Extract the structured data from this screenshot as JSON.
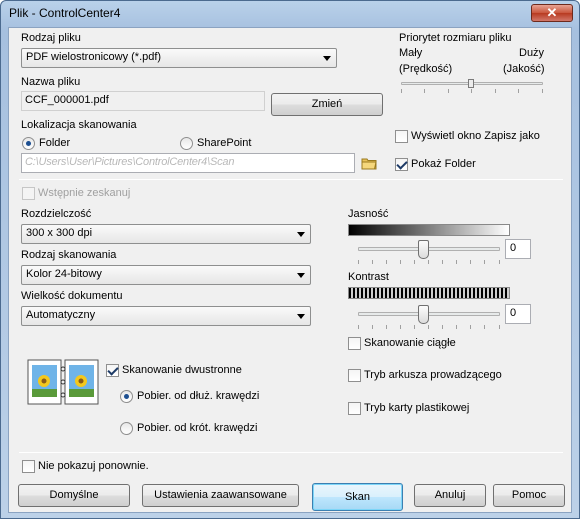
{
  "window": {
    "title": "Plik - ControlCenter4",
    "close_label": "✕"
  },
  "file_type": {
    "label": "Rodzaj pliku",
    "value": "PDF wielostronicowy (*.pdf)"
  },
  "file_name": {
    "label": "Nazwa pliku",
    "value": "CCF_000001.pdf",
    "change_button": "Zmień"
  },
  "size_priority": {
    "label": "Priorytet rozmiaru pliku",
    "left": "Mały",
    "left_sub": "(Prędkość)",
    "right": "Duży",
    "right_sub": "(Jakość)",
    "level": 0.6
  },
  "location": {
    "label": "Lokalizacja skanowania",
    "folder": "Folder",
    "sharepoint": "SharePoint",
    "path": "C:\\Users\\User\\Pictures\\ControlCenter4\\Scan"
  },
  "options": {
    "show_save_as": "Wyświetl okno Zapisz jako",
    "show_folder": "Pokaż Folder",
    "prescan": "Wstępnie zeskanuj"
  },
  "resolution": {
    "label": "Rozdzielczość",
    "value": "300 x 300 dpi"
  },
  "scan_type": {
    "label": "Rodzaj skanowania",
    "value": "Kolor 24-bitowy"
  },
  "doc_size": {
    "label": "Wielkość dokumentu",
    "value": "Automatyczny"
  },
  "brightness": {
    "label": "Jasność",
    "value": "0"
  },
  "contrast": {
    "label": "Kontrast",
    "value": "0"
  },
  "duplex": {
    "label": "Skanowanie dwustronne",
    "long_edge": "Pobier. od dłuż. krawędzi",
    "short_edge": "Pobier. od krót. krawędzi"
  },
  "extras": {
    "continuous": "Skanowanie ciągłe",
    "carrier_sheet": "Tryb arkusza prowadzącego",
    "plastic_card": "Tryb karty plastikowej"
  },
  "dont_show": "Nie pokazuj ponownie.",
  "buttons": {
    "default": "Domyślne",
    "advanced": "Ustawienia zaawansowane",
    "scan": "Skan",
    "cancel": "Anuluj",
    "help": "Pomoc"
  }
}
